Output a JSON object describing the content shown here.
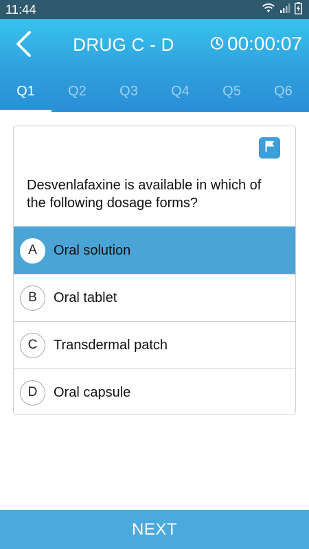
{
  "status_bar": {
    "time": "11:44",
    "icons": [
      "wifi-icon",
      "signal-icon",
      "battery-charging-icon"
    ]
  },
  "header": {
    "title": "DRUG C - D",
    "timer": "00:00:07",
    "back_icon": "chevron-left-icon",
    "timer_icon": "clock-icon"
  },
  "tabs": [
    {
      "label": "Q1",
      "active": true
    },
    {
      "label": "Q2",
      "active": false
    },
    {
      "label": "Q3",
      "active": false
    },
    {
      "label": "Q4",
      "active": false
    },
    {
      "label": "Q5",
      "active": false
    },
    {
      "label": "Q6",
      "active": false
    }
  ],
  "question": {
    "flag_icon": "flag-icon",
    "text": "Desvenlafaxine is available in which of the following dosage forms?",
    "options": [
      {
        "letter": "A",
        "text": "Oral solution",
        "selected": true
      },
      {
        "letter": "B",
        "text": "Oral tablet",
        "selected": false
      },
      {
        "letter": "C",
        "text": "Transdermal patch",
        "selected": false
      },
      {
        "letter": "D",
        "text": "Oral capsule",
        "selected": false
      }
    ]
  },
  "footer": {
    "next_label": "NEXT"
  },
  "colors": {
    "header_top": "#38c3ee",
    "header_bottom": "#2b8fd6",
    "selected_option": "#4aa5d6",
    "next_button": "#4ba9dd",
    "status_bar": "#2f5a6e"
  }
}
